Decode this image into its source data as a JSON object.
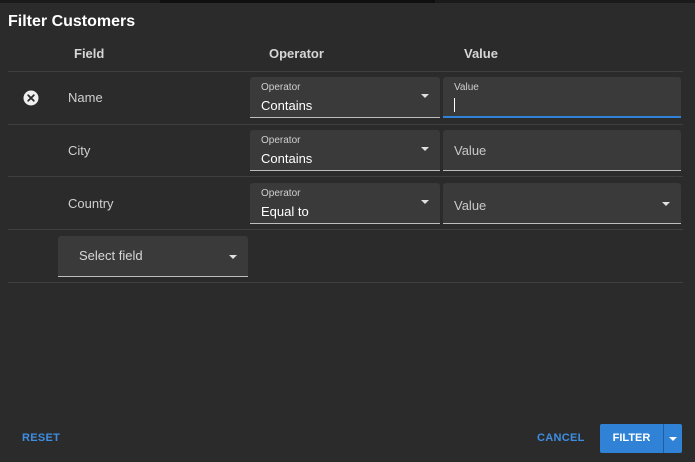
{
  "dialog": {
    "title": "Filter Customers"
  },
  "columns": {
    "field": "Field",
    "operator": "Operator",
    "value": "Value"
  },
  "rows": [
    {
      "field": "Name",
      "operator_label": "Operator",
      "operator": "Contains",
      "value_label": "Value",
      "value": ""
    },
    {
      "field": "City",
      "operator_label": "Operator",
      "operator": "Contains",
      "value_placeholder": "Value"
    },
    {
      "field": "Country",
      "operator_label": "Operator",
      "operator": "Equal to",
      "value_placeholder": "Value"
    }
  ],
  "add_field": {
    "placeholder": "Select field"
  },
  "footer": {
    "reset": "RESET",
    "cancel": "CANCEL",
    "filter": "FILTER"
  },
  "colors": {
    "accent": "#2f82d6",
    "background": "#2b2b2b",
    "input_bg": "#3a3a3a"
  },
  "icons": {
    "remove": "close-circle-icon",
    "dropdown": "caret-down-icon"
  }
}
